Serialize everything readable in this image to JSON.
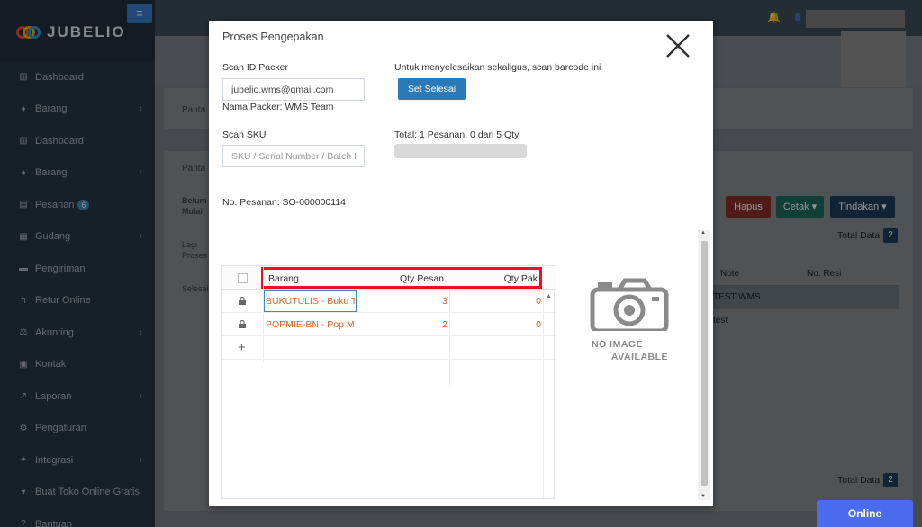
{
  "sidebar": {
    "brand": "JUBELIO",
    "items": [
      {
        "label": "Dashboard",
        "icon": "chart-icon",
        "chevron": false
      },
      {
        "label": "Barang",
        "icon": "tags-icon",
        "chevron": true
      },
      {
        "label": "Dashboard",
        "icon": "chart-icon",
        "chevron": false
      },
      {
        "label": "Barang",
        "icon": "tags-icon",
        "chevron": true
      },
      {
        "label": "Pesanan",
        "icon": "store-icon",
        "chevron": false,
        "badge": "6"
      },
      {
        "label": "Gudang",
        "icon": "building-icon",
        "chevron": true
      },
      {
        "label": "Pengiriman",
        "icon": "truck-icon",
        "chevron": false
      },
      {
        "label": "Retur Online",
        "icon": "reply-icon",
        "chevron": false
      },
      {
        "label": "Akunting",
        "icon": "balance-icon",
        "chevron": true
      },
      {
        "label": "Kontak",
        "icon": "contact-icon",
        "chevron": false
      },
      {
        "label": "Laporan",
        "icon": "line-chart-icon",
        "chevron": true
      },
      {
        "label": "Pengaturan",
        "icon": "gears-icon",
        "chevron": false
      },
      {
        "label": "Integrasi",
        "icon": "plug-icon",
        "chevron": true
      },
      {
        "label": "Buat Toko Online Gratis",
        "icon": "cart-icon",
        "chevron": false
      },
      {
        "label": "Bantuan",
        "icon": "help-icon",
        "chevron": false
      }
    ]
  },
  "background": {
    "tab1": "Panta",
    "tab2": "Panta",
    "col_belum": "Belum",
    "col_mulai": "Mulai",
    "row_lagi": "Lagi",
    "row_proses": "Proses",
    "row_selesai": "Selesai",
    "btn_hapus": "Hapus",
    "btn_cetak": "Cetak",
    "btn_tindakan": "Tindakan",
    "total_data_label": "Total Data",
    "total_data_value": "2",
    "col_note": "Note",
    "col_resi": "No. Resi",
    "note_row1": "TEST WMS",
    "note_row2": "test"
  },
  "modal": {
    "title": "Proses Pengepakan",
    "scan_id_label": "Scan ID Packer",
    "scan_id_value": "jubelio.wms@gmail.com",
    "packer_name": "Nama Packer: WMS Team",
    "finish_hint": "Untuk menyelesaikan sekaligus, scan barcode ini",
    "finish_button": "Set Selesai",
    "scan_sku_label": "Scan SKU",
    "scan_sku_placeholder": "SKU / Serial Number / Batch N",
    "total_text": "Total: 1 Pesanan, 0 dari 5 Qty",
    "progress_fraction": 0,
    "order_number": "No. Pesanan: SO-000000114",
    "grid": {
      "headers": {
        "item": "Barang",
        "qty_order": "Qty Pesan",
        "qty_pack": "Qty Pak"
      },
      "rows": [
        {
          "item": "BUKUTULIS - Buku Tu",
          "qty_order": "3",
          "qty_pack": "0"
        },
        {
          "item": "POPMIE-BN - Pop Mie",
          "qty_order": "2",
          "qty_pack": "0"
        }
      ],
      "add_row": "+"
    },
    "no_image_line1": "NO IMAGE",
    "no_image_line2": "AVAILABLE"
  },
  "online_button": "Online"
}
